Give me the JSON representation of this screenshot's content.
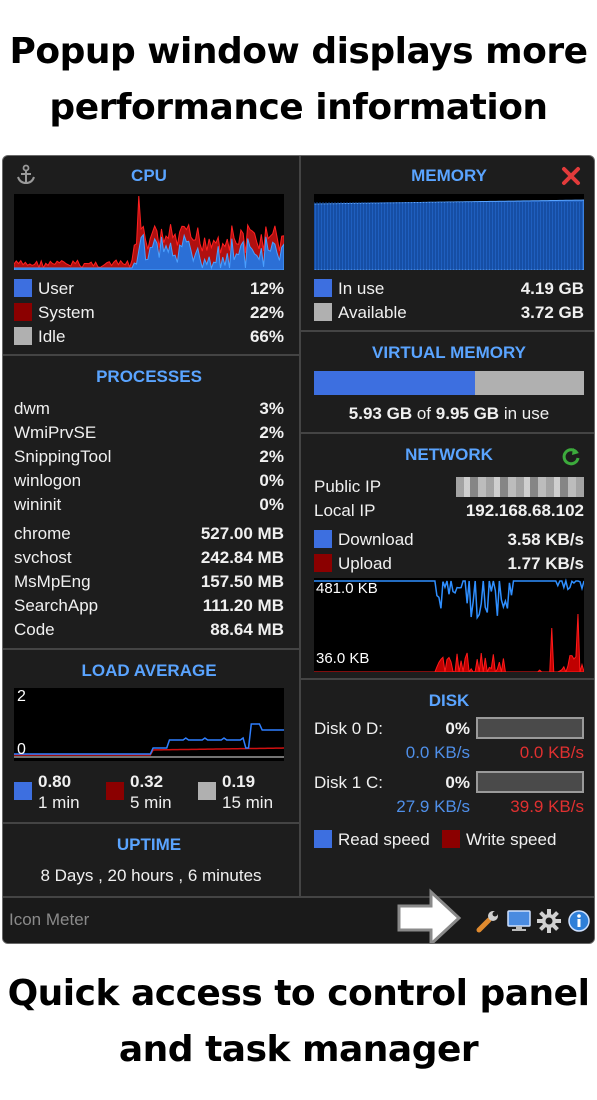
{
  "headline_top": [
    "Popup window displays more",
    "performance information"
  ],
  "headline_bottom": [
    "Quick access to control panel",
    "and task manager"
  ],
  "colors": {
    "user": "#3d6fe0",
    "system": "#8b0000",
    "idle": "#b0b0b0",
    "accent": "#5aa4ff",
    "close": "#e23b3b"
  },
  "cpu": {
    "title": "CPU",
    "rows": [
      {
        "label": "User",
        "value": "12%",
        "color": "#3d6fe0"
      },
      {
        "label": "System",
        "value": "22%",
        "color": "#8b0000"
      },
      {
        "label": "Idle",
        "value": "66%",
        "color": "#b0b0b0"
      }
    ]
  },
  "memory": {
    "title": "MEMORY",
    "rows": [
      {
        "label": "In use",
        "value": "4.19 GB",
        "color": "#3d6fe0"
      },
      {
        "label": "Available",
        "value": "3.72 GB",
        "color": "#b0b0b0"
      }
    ]
  },
  "virtual_memory": {
    "title": "VIRTUAL MEMORY",
    "used_fraction": 0.596,
    "used": "5.93 GB",
    "of": "of",
    "total": "9.95 GB",
    "suffix": "in use"
  },
  "processes": {
    "title": "PROCESSES",
    "cpu_list": [
      {
        "name": "dwm",
        "value": "3%"
      },
      {
        "name": "WmiPrvSE",
        "value": "2%"
      },
      {
        "name": "SnippingTool",
        "value": "2%"
      },
      {
        "name": "winlogon",
        "value": "0%"
      },
      {
        "name": "wininit",
        "value": "0%"
      }
    ],
    "mem_list": [
      {
        "name": "chrome",
        "value": "527.00 MB"
      },
      {
        "name": "svchost",
        "value": "242.84 MB"
      },
      {
        "name": "MsMpEng",
        "value": "157.50 MB"
      },
      {
        "name": "SearchApp",
        "value": "111.20 MB"
      },
      {
        "name": "Code",
        "value": "88.64 MB"
      }
    ]
  },
  "network": {
    "title": "NETWORK",
    "public_ip_label": "Public IP",
    "local_ip_label": "Local IP",
    "local_ip": "192.168.68.102",
    "download_label": "Download",
    "download": "3.58 KB/s",
    "upload_label": "Upload",
    "upload": "1.77 KB/s",
    "graph_top_label": "481.0 KB",
    "graph_bottom_label": "36.0 KB"
  },
  "load_average": {
    "title": "LOAD AVERAGE",
    "y_top": "2",
    "y_bottom": "0",
    "items": [
      {
        "value": "0.80",
        "period": "1 min",
        "color": "#3d6fe0"
      },
      {
        "value": "0.32",
        "period": "5 min",
        "color": "#8b0000"
      },
      {
        "value": "0.19",
        "period": "15 min",
        "color": "#b0b0b0"
      }
    ]
  },
  "disk": {
    "title": "DISK",
    "disks": [
      {
        "label": "Disk 0 D:",
        "percent": "0%",
        "read": "0.0 KB/s",
        "write": "0.0 KB/s"
      },
      {
        "label": "Disk 1 C:",
        "percent": "0%",
        "read": "27.9 KB/s",
        "write": "39.9 KB/s"
      }
    ],
    "read_label": "Read speed",
    "write_label": "Write speed"
  },
  "uptime": {
    "title": "UPTIME",
    "value": "8 Days , 20 hours , 6 minutes"
  },
  "bottom_bar": {
    "app_name": "Icon Meter",
    "icons": [
      "wrench-icon",
      "monitor-icon",
      "gear-icon",
      "info-icon"
    ]
  }
}
